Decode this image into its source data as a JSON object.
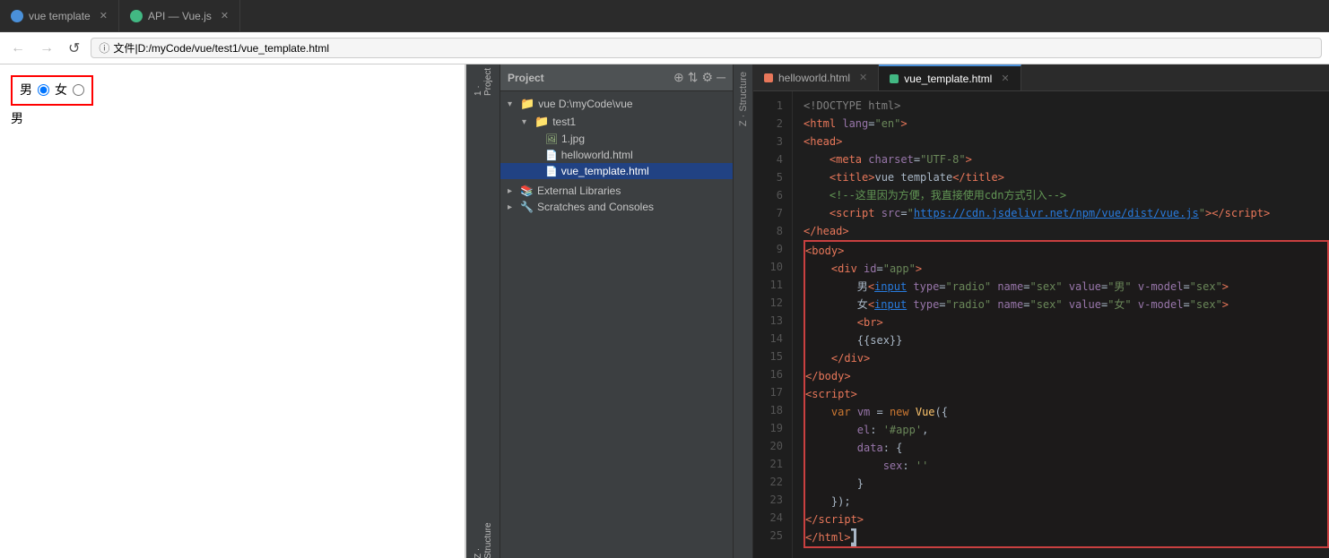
{
  "browser": {
    "tab_label": "vue template",
    "tab2_label": "API — Vue.js",
    "url": "D:/myCode/vue/test1/vue_template.html",
    "url_protocol": "文件",
    "nav_back": "←",
    "nav_forward": "→",
    "nav_reload": "C",
    "radio_label_male": "男",
    "radio_label_female": "女",
    "result": "男",
    "chrome_icon": "C",
    "firefox_icon": "F"
  },
  "ide": {
    "project_title": "Project",
    "project_tree": [
      {
        "indent": 0,
        "type": "folder",
        "label": "vue  D:\\myCode\\vue",
        "expanded": true
      },
      {
        "indent": 1,
        "type": "folder",
        "label": "test1",
        "expanded": true
      },
      {
        "indent": 2,
        "type": "img",
        "label": "1.jpg"
      },
      {
        "indent": 2,
        "type": "html",
        "label": "helloworld.html"
      },
      {
        "indent": 2,
        "type": "html",
        "label": "vue_template.html",
        "selected": true
      }
    ],
    "external_libraries": "External Libraries",
    "scratches": "Scratches and Consoles",
    "tabs": [
      {
        "label": "helloworld.html",
        "active": false,
        "type": "html"
      },
      {
        "label": "vue_template.html",
        "active": true,
        "type": "vue"
      }
    ],
    "code_lines": [
      {
        "num": 1,
        "content": "<!DOCTYPE html>"
      },
      {
        "num": 2,
        "content": "<html lang=\"en\">"
      },
      {
        "num": 3,
        "content": "<head>"
      },
      {
        "num": 4,
        "content": "    <meta charset=\"UTF-8\">"
      },
      {
        "num": 5,
        "content": "    <title>vue template</title>"
      },
      {
        "num": 6,
        "content": "    <!--这里因为方便，我直接使用cdn方式引入-->"
      },
      {
        "num": 7,
        "content": "    <script src=\"https://cdn.jsdelivr.net/npm/vue/dist/vue.js\"><\\/script>"
      },
      {
        "num": 8,
        "content": "</head>"
      },
      {
        "num": 9,
        "content": "<body>"
      },
      {
        "num": 10,
        "content": "    <div id=\"app\">"
      },
      {
        "num": 11,
        "content": "        男<input type=\"radio\" name=\"sex\" value=\"男\" v-model=\"sex\">"
      },
      {
        "num": 12,
        "content": "        女<input type=\"radio\" name=\"sex\" value=\"女\" v-model=\"sex\">"
      },
      {
        "num": 13,
        "content": "        <br>"
      },
      {
        "num": 14,
        "content": "        {{sex}}"
      },
      {
        "num": 15,
        "content": "    </div>"
      },
      {
        "num": 16,
        "content": "</body>"
      },
      {
        "num": 17,
        "content": "<script>"
      },
      {
        "num": 18,
        "content": "    var vm = new Vue({"
      },
      {
        "num": 19,
        "content": "        el: '#app',"
      },
      {
        "num": 20,
        "content": "        data: {"
      },
      {
        "num": 21,
        "content": "            sex: ''"
      },
      {
        "num": 22,
        "content": "        }"
      },
      {
        "num": 23,
        "content": "    });"
      },
      {
        "num": 24,
        "content": "<\\/script>"
      },
      {
        "num": 25,
        "content": "</html>"
      }
    ]
  }
}
